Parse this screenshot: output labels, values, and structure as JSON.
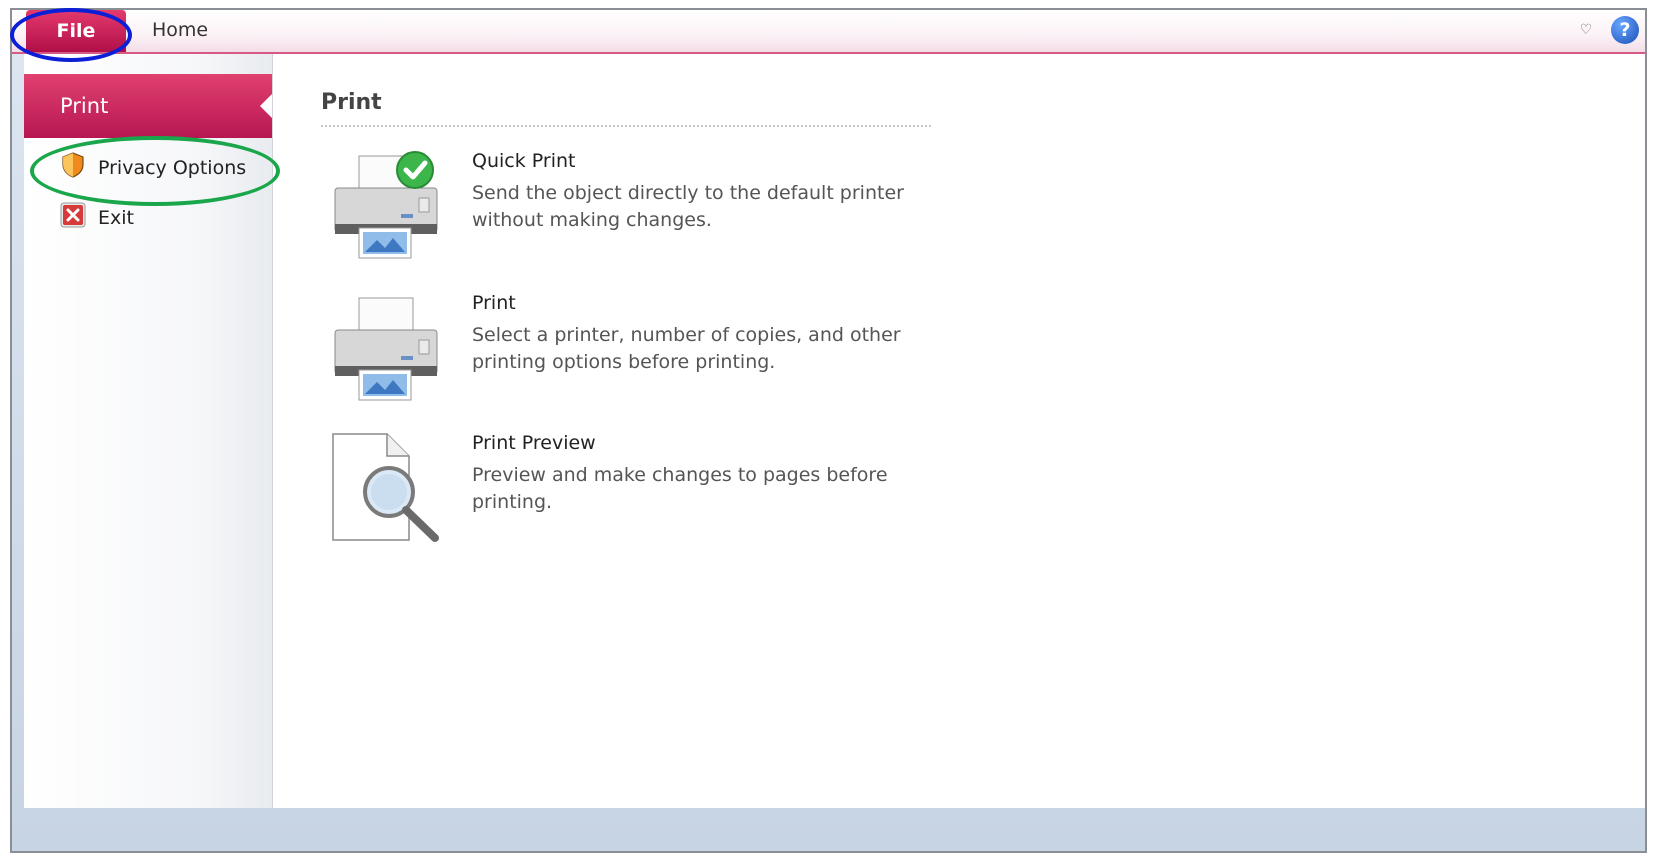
{
  "ribbon": {
    "tabs": [
      {
        "label": "File",
        "active": true
      },
      {
        "label": "Home",
        "active": false
      }
    ],
    "help_symbol": "?",
    "minimize_symbol": "♡"
  },
  "sidebar": {
    "selected": "Print",
    "items": [
      {
        "label": "Privacy Options",
        "icon": "shield-icon"
      },
      {
        "label": "Exit",
        "icon": "close-icon"
      }
    ]
  },
  "main": {
    "section_title": "Print",
    "options": [
      {
        "title": "Quick Print",
        "description": "Send the object directly to the default printer without making changes.",
        "icon": "quick-print-icon"
      },
      {
        "title": "Print",
        "description": "Select a printer, number of copies, and other printing options before printing.",
        "icon": "printer-icon"
      },
      {
        "title": "Print Preview",
        "description": "Preview and make changes to pages before printing.",
        "icon": "print-preview-icon"
      }
    ]
  },
  "annotations": {
    "file_circle_color": "#0b1fd6",
    "privacy_circle_color": "#1aa64a"
  },
  "colors": {
    "accent": "#c21a55",
    "frame_border": "#8a8f96"
  }
}
